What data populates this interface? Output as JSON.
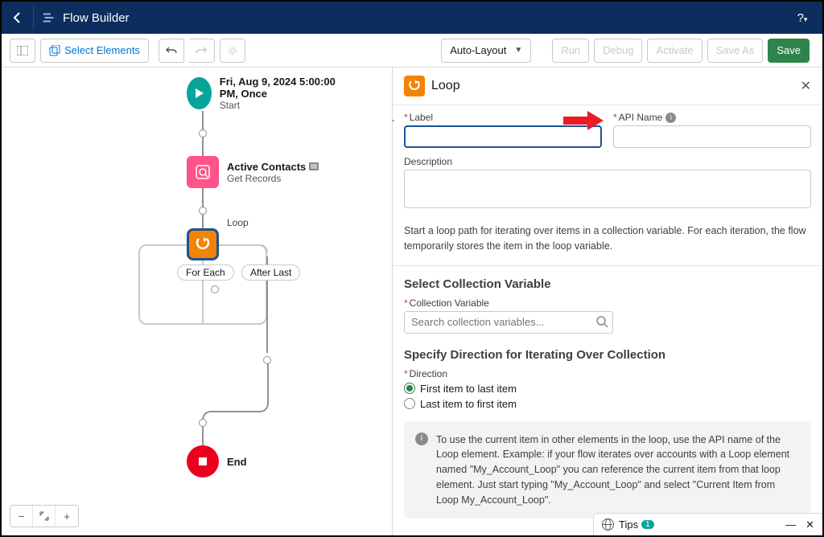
{
  "header": {
    "title": "Flow Builder",
    "help": "?"
  },
  "toolbar": {
    "select_elements": "Select Elements",
    "layout_mode": "Auto-Layout",
    "run": "Run",
    "debug": "Debug",
    "activate": "Activate",
    "save_as": "Save As",
    "save": "Save"
  },
  "canvas": {
    "start": {
      "title": "Fri, Aug 9, 2024 5:00:00 PM, Once",
      "sub": "Start"
    },
    "get": {
      "title": "Active Contacts",
      "sub": "Get Records"
    },
    "loop_label": "Loop",
    "for_each": "For Each",
    "after_last": "After Last",
    "end": "End"
  },
  "panel": {
    "title": "Loop",
    "label_field": "Label",
    "api_name_field": "API Name",
    "description_field": "Description",
    "intro": "Start a loop path for iterating over items in a collection variable. For each iteration, the flow temporarily stores the item in the loop variable.",
    "collection_section": "Select Collection Variable",
    "collection_label": "Collection Variable",
    "collection_placeholder": "Search collection variables...",
    "direction_section": "Specify Direction for Iterating Over Collection",
    "direction_label": "Direction",
    "radio_first": "First item to last item",
    "radio_last": "Last item to first item",
    "info_text": "To use the current item in other elements in the loop, use the API name of the Loop element. Example: if your flow iterates over accounts with a Loop element named \"My_Account_Loop\" you can reference the current item from that loop element. Just start typing \"My_Account_Loop\" and select \"Current Item from Loop My_Account_Loop\"."
  },
  "tips": {
    "label": "Tips",
    "count": "1"
  }
}
